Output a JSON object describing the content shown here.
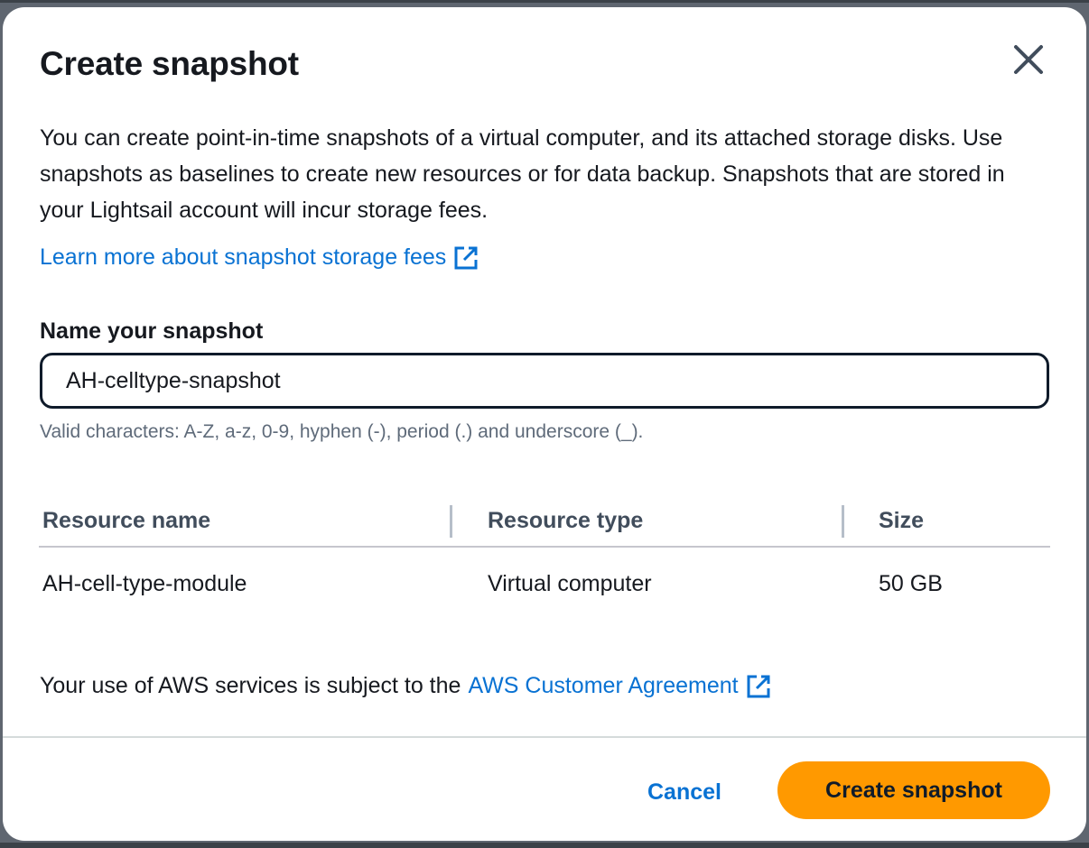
{
  "dialog": {
    "title": "Create snapshot",
    "close_icon": "close-icon",
    "description": "You can create point-in-time snapshots of a virtual computer, and its attached storage disks. Use snapshots as baselines to create new resources or for data backup. Snapshots that are stored in your Lightsail account will incur storage fees.",
    "learn_more_link": "Learn more about snapshot storage fees",
    "external_link_icon": "external-link-icon"
  },
  "form": {
    "label": "Name your snapshot",
    "value": "AH-celltype-snapshot",
    "hint": "Valid characters: A-Z, a-z, 0-9, hyphen (-), period (.) and underscore (_)."
  },
  "table": {
    "columns": [
      "Resource name",
      "Resource type",
      "Size"
    ],
    "rows": [
      [
        "AH-cell-type-module",
        "Virtual computer",
        "50 GB"
      ]
    ]
  },
  "agreement": {
    "text": "Your use of AWS services is subject to the",
    "link": "AWS Customer Agreement"
  },
  "footer": {
    "cancel_label": "Cancel",
    "create_label": "Create snapshot"
  },
  "colors": {
    "primary_button": "#ff9900",
    "link": "#0972d3",
    "text": "#16191f",
    "input_border": "#0f1b2a"
  }
}
